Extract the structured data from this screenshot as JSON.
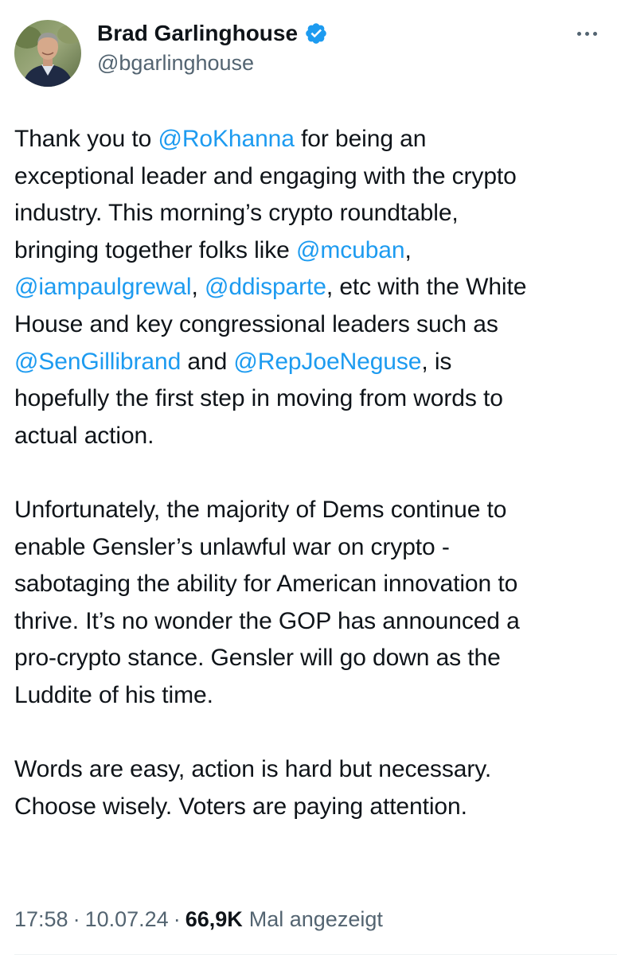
{
  "author": {
    "display_name": "Brad Garlinghouse",
    "handle": "@bgarlinghouse",
    "verified": true
  },
  "tweet": {
    "paragraphs": [
      [
        [
          {
            "t": "Thank you to "
          },
          {
            "t": "@RoKhanna",
            "m": true
          },
          {
            "t": " for being an"
          }
        ],
        [
          {
            "t": "exceptional leader and engaging with the crypto"
          }
        ],
        [
          {
            "t": "industry. This morning’s crypto roundtable,"
          }
        ],
        [
          {
            "t": "bringing together folks like "
          },
          {
            "t": "@mcuban",
            "m": true
          },
          {
            "t": ","
          }
        ],
        [
          {
            "t": "@iampaulgrewal",
            "m": true
          },
          {
            "t": ", "
          },
          {
            "t": "@ddisparte",
            "m": true
          },
          {
            "t": ", etc with the White"
          }
        ],
        [
          {
            "t": "House and key congressional leaders such as"
          }
        ],
        [
          {
            "t": "@SenGillibrand",
            "m": true
          },
          {
            "t": " and "
          },
          {
            "t": "@RepJoeNeguse",
            "m": true
          },
          {
            "t": ", is"
          }
        ],
        [
          {
            "t": "hopefully the first step in moving from words to"
          }
        ],
        [
          {
            "t": "actual action."
          }
        ]
      ],
      [
        [
          {
            "t": "Unfortunately, the majority of Dems continue to"
          }
        ],
        [
          {
            "t": "enable Gensler’s unlawful war on crypto -"
          }
        ],
        [
          {
            "t": "sabotaging the ability for American innovation to"
          }
        ],
        [
          {
            "t": "thrive. It’s no wonder the GOP has announced a"
          }
        ],
        [
          {
            "t": "pro-crypto stance. Gensler will go down as the"
          }
        ],
        [
          {
            "t": "Luddite of his time."
          }
        ]
      ],
      [
        [
          {
            "t": "Words are easy, action is hard but necessary."
          }
        ],
        [
          {
            "t": "Choose wisely. Voters are paying attention."
          }
        ]
      ]
    ]
  },
  "meta": {
    "time": "17:58",
    "separator": "·",
    "date": "10.07.24",
    "views_count": "66,9K",
    "views_label": "Mal angezeigt"
  },
  "colors": {
    "text": "#0f1419",
    "secondary": "#536471",
    "link": "#1d9bf0",
    "verified": "#1d9bf0"
  },
  "icons": {
    "verified": "verified-badge-icon",
    "more": "more-options-icon"
  }
}
